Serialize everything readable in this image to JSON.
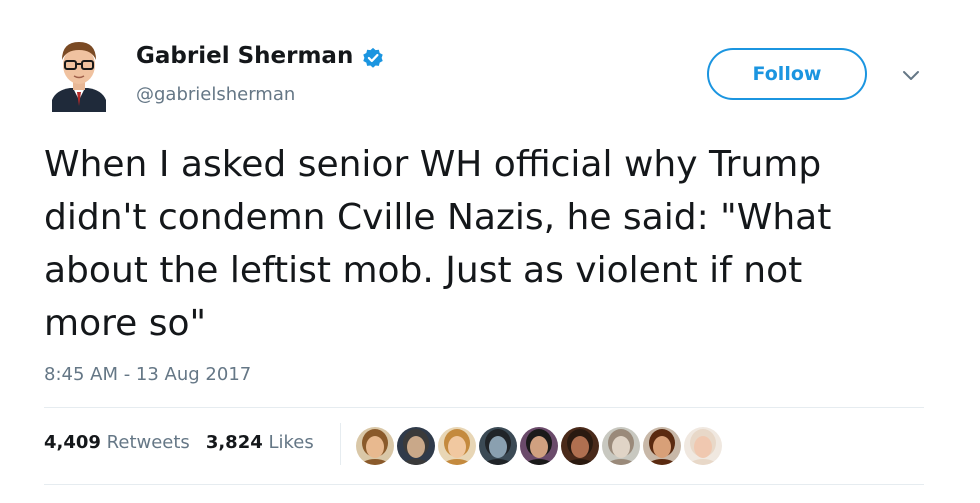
{
  "author": {
    "name": "Gabriel Sherman",
    "handle": "@gabrielsherman",
    "verified": true,
    "avatar_icon": "profile-photo"
  },
  "follow_button": {
    "label": "Follow"
  },
  "menu_icon": "chevron-down-icon",
  "tweet": {
    "text": "When I asked senior WH official why Trump\ndidn't condemn Cville Nazis, he said: \"What\nabout the leftist mob. Just as violent if not\nmore so\""
  },
  "timestamp": "8:45 AM - 13 Aug 2017",
  "stats": {
    "retweets_count": "4,409",
    "retweets_label": "Retweets",
    "likes_count": "3,824",
    "likes_label": "Likes"
  },
  "likers": [
    {
      "icon": "liker-avatar",
      "skin": "#e8b98f",
      "hair": "#8a5a2b",
      "bg": "#d9c7a7"
    },
    {
      "icon": "liker-avatar",
      "skin": "#c9a889",
      "hair": "#3a3a3a",
      "bg": "#2f3a4a"
    },
    {
      "icon": "liker-avatar",
      "skin": "#f1c8a0",
      "hair": "#c48a3e",
      "bg": "#e8d6b5"
    },
    {
      "icon": "liker-avatar",
      "skin": "#8aa0b0",
      "hair": "#202428",
      "bg": "#3b4a55"
    },
    {
      "icon": "liker-avatar",
      "skin": "#d0a080",
      "hair": "#1a1a1a",
      "bg": "#6a4a6a"
    },
    {
      "icon": "liker-avatar",
      "skin": "#b07050",
      "hair": "#2a1a10",
      "bg": "#4a2a1a"
    },
    {
      "icon": "liker-avatar",
      "skin": "#e0d4c6",
      "hair": "#9a8a7a",
      "bg": "#c8c8c0"
    },
    {
      "icon": "liker-avatar",
      "skin": "#d8a078",
      "hair": "#5a2a10",
      "bg": "#c8b8a8"
    },
    {
      "icon": "liker-avatar",
      "skin": "#f0c8b0",
      "hair": "#e8d8c8",
      "bg": "#f0e8e0"
    }
  ],
  "colors": {
    "accent": "#1b95e0",
    "secondary_text": "#657786",
    "primary_text": "#14171a",
    "divider": "#e6ecf0"
  }
}
